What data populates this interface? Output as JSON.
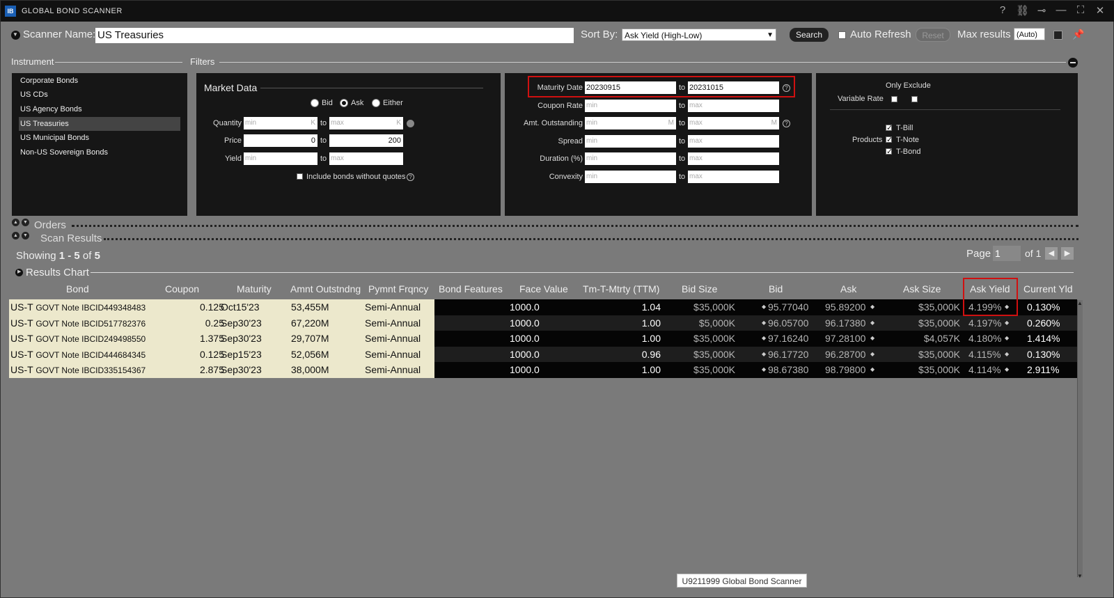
{
  "window": {
    "title": "GLOBAL BOND SCANNER",
    "logo": "IB",
    "controls": [
      "?",
      "link-icon",
      "pin-icon",
      "minimize-icon",
      "maximize-icon",
      "close-icon"
    ]
  },
  "toolbar": {
    "scanner_label": "Scanner Name:",
    "scanner_value": "US Treasuries",
    "sort_label": "Sort By:",
    "sort_value": "Ask Yield (High-Low)",
    "search_label": "Search",
    "auto_refresh_label": "Auto Refresh",
    "reset_label": "Reset",
    "max_results_label": "Max results",
    "max_results_value": "(Auto)"
  },
  "sections": {
    "instrument": "Instrument",
    "filters": "Filters"
  },
  "instruments": [
    "Corporate Bonds",
    "US CDs",
    "US Agency Bonds",
    "US Treasuries",
    "US Municipal Bonds",
    "Non-US Sovereign Bonds"
  ],
  "selected_instrument": "US Treasuries",
  "market_data": {
    "title": "Market Data",
    "radio_bid": "Bid",
    "radio_ask": "Ask",
    "radio_either": "Either",
    "selected": "Ask",
    "quantity_label": "Quantity",
    "price_label": "Price",
    "yield_label": "Yield",
    "min": "min",
    "max": "max",
    "unit_k": "K",
    "to": "to",
    "price_min": "0",
    "price_max": "200",
    "include_label": "Include bonds without quotes"
  },
  "filters_mid": {
    "maturity_label": "Maturity Date",
    "maturity_from": "20230915",
    "maturity_to": "20231015",
    "coupon_label": "Coupon Rate",
    "amt_label": "Amt. Outstanding",
    "unit_m": "M",
    "spread_label": "Spread",
    "duration_label": "Duration (%)",
    "convexity_label": "Convexity",
    "min": "min",
    "max": "max",
    "to": "to"
  },
  "filters_right": {
    "only_exclude": "Only Exclude",
    "variable_rate": "Variable Rate",
    "products_label": "Products",
    "products": [
      "T-Bill",
      "T-Note",
      "T-Bond"
    ]
  },
  "collapsibles": {
    "orders": "Orders",
    "scan_results": "Scan Results",
    "results_chart": "Results Chart"
  },
  "paging": {
    "showing_prefix": "Showing ",
    "range": "1 - 5",
    "of_word": " of ",
    "total": "5",
    "page_label": "Page",
    "page_value": "1",
    "of_pages": "of 1"
  },
  "columns": [
    "Bond",
    "Coupon",
    "Maturity",
    "Amnt Outstndng",
    "Pymnt Frqncy",
    "Bond Features",
    "Face Value",
    "Tm-T-Mtrty (TTM)",
    "Bid Size",
    "Bid",
    "Ask",
    "Ask Size",
    "Ask Yield",
    "Current Yld"
  ],
  "rows": [
    {
      "bond_a": "US-T",
      "bond_b": "GOVT Note IBCID449348483",
      "coupon": "0.125",
      "maturity": "Oct15'23",
      "amount": "53,455M",
      "freq": "Semi-Annual",
      "face": "1000.0",
      "ttm": "1.04",
      "bid_size": "$35,000K",
      "bid": "95.77040",
      "ask": "95.89200",
      "ask_size": "$35,000K",
      "ask_yield": "4.199%",
      "current_yld": "0.130%"
    },
    {
      "bond_a": "US-T",
      "bond_b": "GOVT Note IBCID517782376",
      "coupon": "0.25",
      "maturity": "Sep30'23",
      "amount": "67,220M",
      "freq": "Semi-Annual",
      "face": "1000.0",
      "ttm": "1.00",
      "bid_size": "$5,000K",
      "bid": "96.05700",
      "ask": "96.17380",
      "ask_size": "$35,000K",
      "ask_yield": "4.197%",
      "current_yld": "0.260%"
    },
    {
      "bond_a": "US-T",
      "bond_b": "GOVT Note IBCID249498550",
      "coupon": "1.375",
      "maturity": "Sep30'23",
      "amount": "29,707M",
      "freq": "Semi-Annual",
      "face": "1000.0",
      "ttm": "1.00",
      "bid_size": "$35,000K",
      "bid": "97.16240",
      "ask": "97.28100",
      "ask_size": "$4,057K",
      "ask_yield": "4.180%",
      "current_yld": "1.414%"
    },
    {
      "bond_a": "US-T",
      "bond_b": "GOVT Note IBCID444684345",
      "coupon": "0.125",
      "maturity": "Sep15'23",
      "amount": "52,056M",
      "freq": "Semi-Annual",
      "face": "1000.0",
      "ttm": "0.96",
      "bid_size": "$35,000K",
      "bid": "96.17720",
      "ask": "96.28700",
      "ask_size": "$35,000K",
      "ask_yield": "4.115%",
      "current_yld": "0.130%"
    },
    {
      "bond_a": "US-T",
      "bond_b": "GOVT Note IBCID335154367",
      "coupon": "2.875",
      "maturity": "Sep30'23",
      "amount": "38,000M",
      "freq": "Semi-Annual",
      "face": "1000.0",
      "ttm": "1.00",
      "bid_size": "$35,000K",
      "bid": "98.67380",
      "ask": "98.79800",
      "ask_size": "$35,000K",
      "ask_yield": "4.114%",
      "current_yld": "2.911%"
    }
  ],
  "footer_tag": "U9211999 Global Bond Scanner"
}
